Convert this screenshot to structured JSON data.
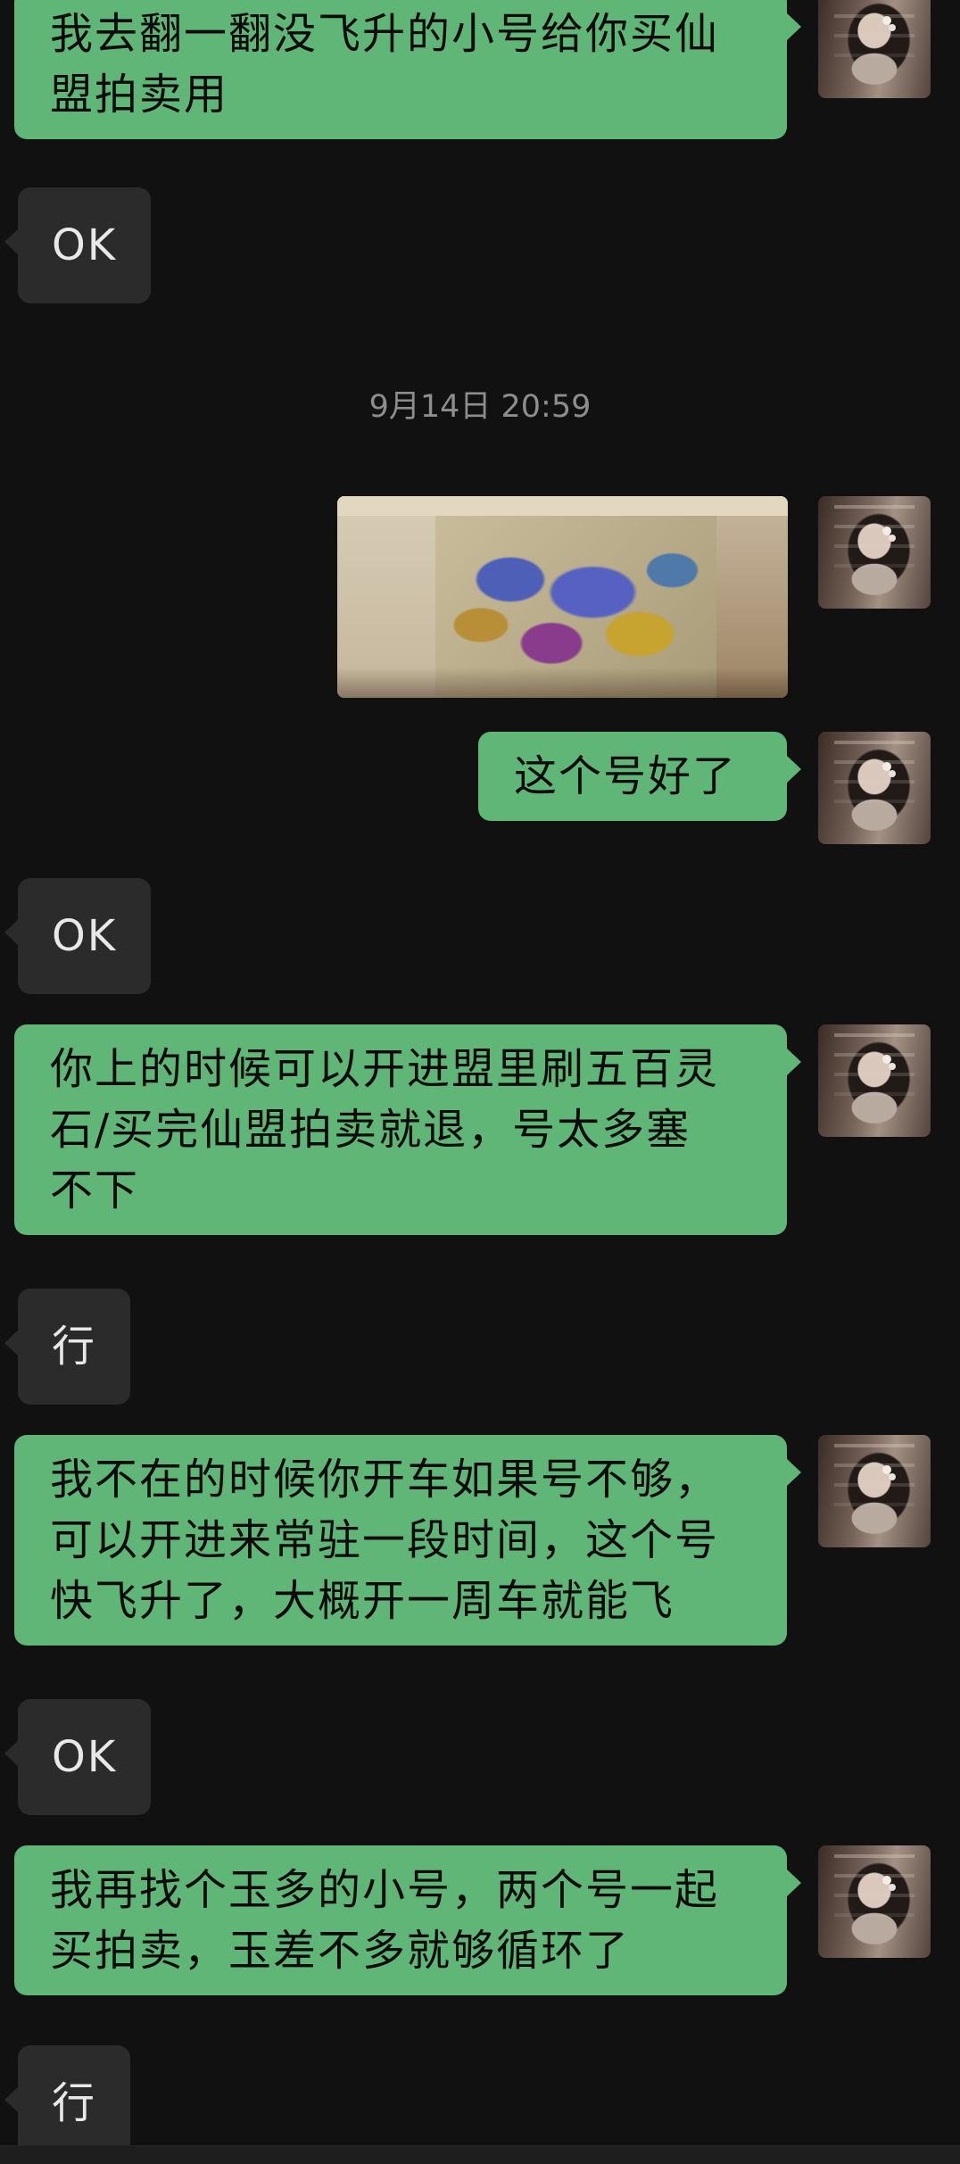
{
  "chat": {
    "messages": [
      {
        "id": "m1",
        "side": "sent",
        "text": "我去翻一翻没飞升的小号给你买仙\n盟拍卖用"
      },
      {
        "id": "m2",
        "side": "received",
        "text": "OK"
      },
      {
        "id": "m3",
        "side": "sent",
        "kind": "image"
      },
      {
        "id": "m4",
        "side": "sent",
        "text": "这个号好了"
      },
      {
        "id": "m5",
        "side": "received",
        "text": "OK"
      },
      {
        "id": "m6",
        "side": "sent",
        "text": "你上的时候可以开进盟里刷五百灵\n石/买完仙盟拍卖就退，号太多塞\n不下"
      },
      {
        "id": "m7",
        "side": "received",
        "text": "行"
      },
      {
        "id": "m8",
        "side": "sent",
        "text": "我不在的时候你开车如果号不够，\n可以开进来常驻一段时间，这个号\n快飞升了，大概开一周车就能飞"
      },
      {
        "id": "m9",
        "side": "received",
        "text": "OK"
      },
      {
        "id": "m10",
        "side": "sent",
        "text": "我再找个玉多的小号，两个号一起\n买拍卖，玉差不多就够循环了"
      },
      {
        "id": "m11",
        "side": "received",
        "text": "行"
      }
    ],
    "timestamp": "9月14日 20:59"
  },
  "colors": {
    "background": "#111111",
    "sent_bubble": "#5fb677",
    "received_bubble": "#2b2b2b",
    "timestamp_text": "#8d8d8d"
  }
}
